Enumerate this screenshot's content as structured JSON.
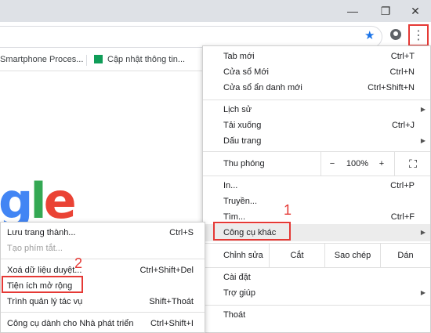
{
  "window": {
    "minimize": "—",
    "restore": "❐",
    "close": "✕"
  },
  "toolbar": {
    "star_icon": "★",
    "kebab_icon": "⋮"
  },
  "bookmarks": [
    {
      "label": "Smartphone Proces..."
    },
    {
      "label": "Cập nhật thông tin..."
    }
  ],
  "logo": {
    "letters": [
      "g",
      "l",
      "e"
    ],
    "colors": [
      "#4285F4",
      "#34A853",
      "#EA4335"
    ]
  },
  "main_menu": {
    "items_a": [
      {
        "label": "Tab mới",
        "shortcut": "Ctrl+T"
      },
      {
        "label": "Cửa sổ Mới",
        "shortcut": "Ctrl+N"
      },
      {
        "label": "Cửa sổ ẩn danh mới",
        "shortcut": "Ctrl+Shift+N"
      }
    ],
    "items_b": [
      {
        "label": "Lịch sử",
        "arrow": "▶"
      },
      {
        "label": "Tải xuống",
        "shortcut": "Ctrl+J"
      },
      {
        "label": "Dấu trang",
        "arrow": "▶"
      }
    ],
    "zoom": {
      "label": "Thu phóng",
      "minus": "−",
      "value": "100%",
      "plus": "+",
      "fullscreen": "⛶"
    },
    "items_c": [
      {
        "label": "In...",
        "shortcut": "Ctrl+P"
      },
      {
        "label": "Truyền...",
        "shortcut": ""
      },
      {
        "label": "Tìm...",
        "shortcut": "Ctrl+F"
      },
      {
        "label": "Công cụ khác",
        "arrow": "▶"
      }
    ],
    "edit": {
      "label": "Chỉnh sửa",
      "cut": "Cắt",
      "copy": "Sao chép",
      "paste": "Dán"
    },
    "items_d": [
      {
        "label": "Cài đặt"
      },
      {
        "label": "Trợ giúp",
        "arrow": "▶"
      }
    ],
    "exit": "Thoát"
  },
  "sub_menu": {
    "items": [
      {
        "label": "Lưu trang thành...",
        "shortcut": "Ctrl+S"
      },
      {
        "label": "Tạo phím tắt...",
        "shortcut": "",
        "disabled": true
      },
      {
        "label": "Xoá dữ liệu duyệt...",
        "shortcut": "Ctrl+Shift+Del"
      },
      {
        "label": "Tiện ích mở rộng",
        "shortcut": ""
      },
      {
        "label": "Trình quản lý tác vụ",
        "shortcut": "Shift+Thoát"
      },
      {
        "label": "Công cụ dành cho Nhà phát triển",
        "shortcut": "Ctrl+Shift+I"
      }
    ]
  },
  "annotations": {
    "step1": "1",
    "step2": "2"
  },
  "accent_red": "#e53935"
}
